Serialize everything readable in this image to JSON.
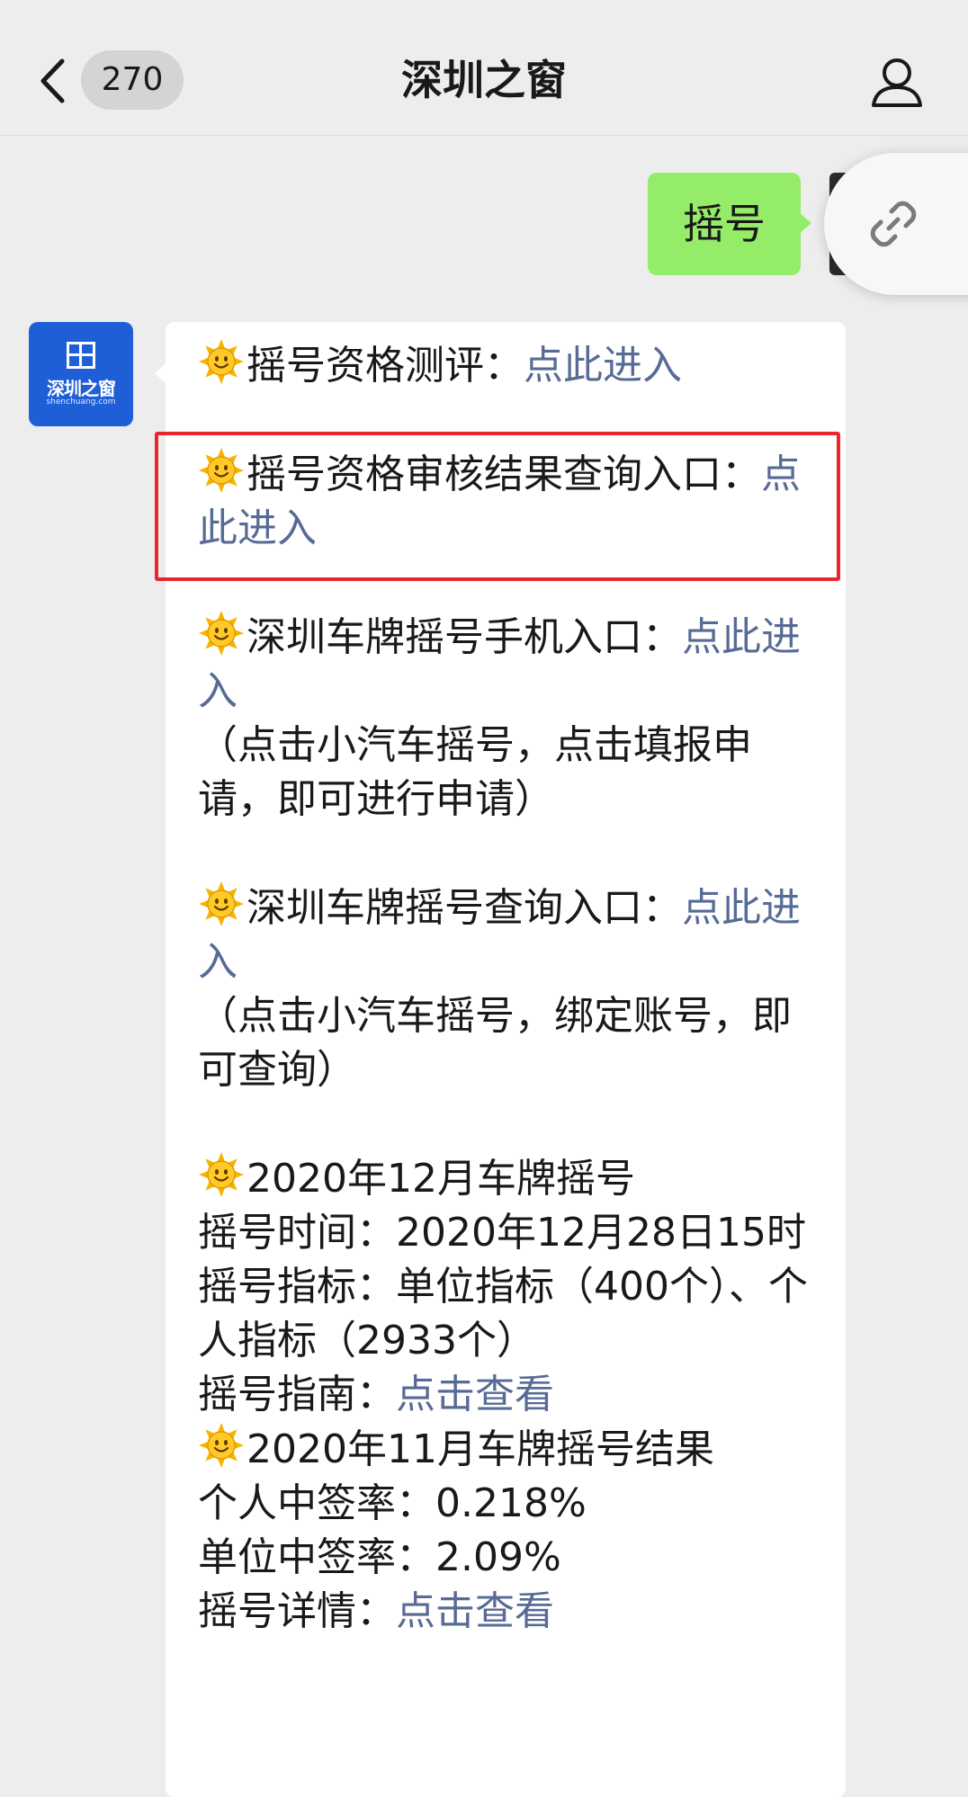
{
  "navbar": {
    "title": "深圳之窗",
    "unread_count": "270",
    "back_icon": "chevron-left-icon",
    "profile_icon": "person-icon"
  },
  "sent_message": {
    "text": "摇号",
    "bubble_color": "#95ec69"
  },
  "received_message": {
    "avatar_logo_text": "深圳之窗",
    "avatar_logo_domain": "shenchuang.com",
    "avatar_color": "#1e5fd8",
    "link_color": "#576b95",
    "highlight_color": "#e8262b",
    "items": {
      "eval_label": "摇号资格测评：",
      "eval_link": "点此进入",
      "audit_label": "摇号资格审核结果查询入口：",
      "audit_link": "点此进入",
      "mobile_label": "深圳车牌摇号手机入口：",
      "mobile_link": "点此进入",
      "mobile_note": "（点击小汽车摇号，点击填报申请，即可进行申请）",
      "query_label": "深圳车牌摇号查询入口：",
      "query_link": "点此进入",
      "query_note": "（点击小汽车摇号，绑定账号，即可查询）",
      "dec_title": "2020年12月车牌摇号",
      "dec_time": "摇号时间：2020年12月28日15时",
      "dec_quota": "摇号指标：单位指标（400个）、个人指标（2933个）",
      "dec_guide_label": "摇号指南：",
      "dec_guide_link": "点击查看",
      "nov_title": "2020年11月车牌摇号结果",
      "nov_personal_rate": "个人中签率：0.218%",
      "nov_company_rate": "单位中签率：2.09%",
      "nov_detail_label": "摇号详情：",
      "nov_detail_link": "点击查看"
    }
  }
}
